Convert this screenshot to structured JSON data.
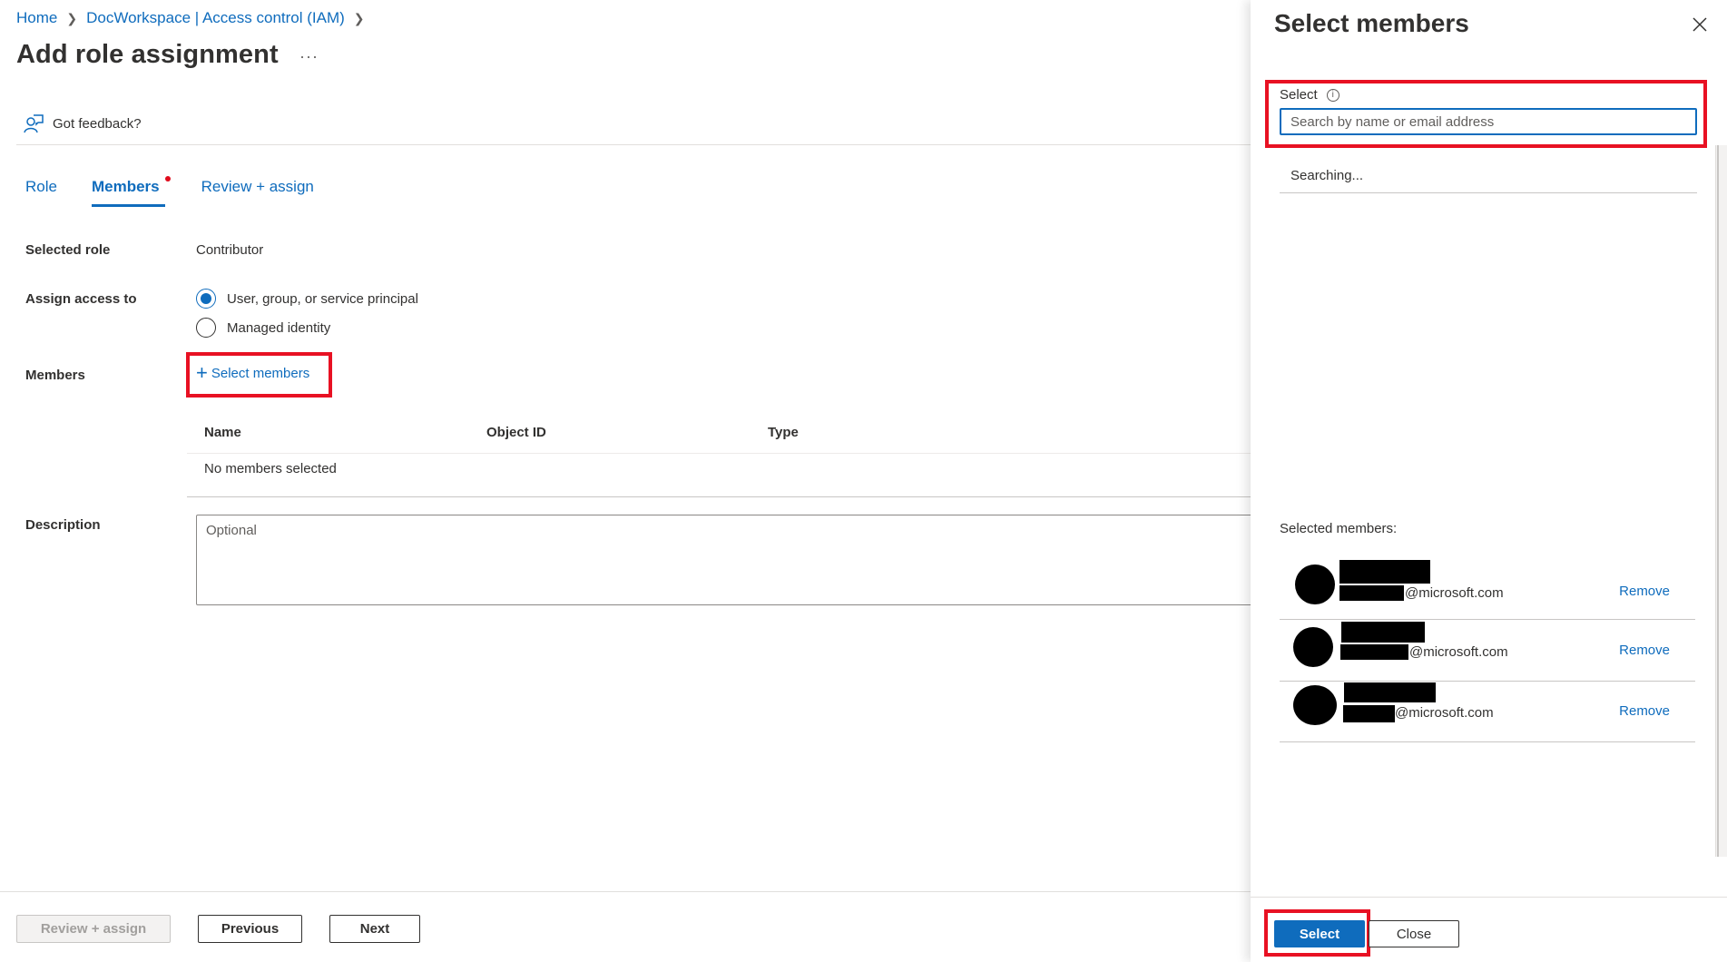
{
  "breadcrumb": [
    {
      "label": "Home"
    },
    {
      "label": "DocWorkspace | Access control (IAM)"
    }
  ],
  "page": {
    "title": "Add role assignment",
    "more_label": "···",
    "feedback_label": "Got feedback?"
  },
  "tabs": [
    {
      "label": "Role",
      "active": false
    },
    {
      "label": "Members",
      "active": true,
      "has_indicator": true
    },
    {
      "label": "Review + assign",
      "active": false
    }
  ],
  "form": {
    "selected_role_label": "Selected role",
    "selected_role_value": "Contributor",
    "assign_access_label": "Assign access to",
    "assign_options": [
      {
        "label": "User, group, or service principal",
        "checked": true
      },
      {
        "label": "Managed identity",
        "checked": false
      }
    ],
    "members_label": "Members",
    "select_members_link": "Select members",
    "table": {
      "columns": [
        "Name",
        "Object ID",
        "Type"
      ],
      "empty_text": "No members selected"
    },
    "description_label": "Description",
    "description_placeholder": "Optional"
  },
  "footer": {
    "review_assign": "Review + assign",
    "previous": "Previous",
    "next": "Next"
  },
  "panel": {
    "title": "Select members",
    "select_label": "Select",
    "search_placeholder": "Search by name or email address",
    "search_value": "",
    "status_text": "Searching...",
    "selected_members_label": "Selected members:",
    "members": [
      {
        "name": "[redacted]",
        "email_domain": "@microsoft.com",
        "remove_label": "Remove"
      },
      {
        "name": "[redacted]",
        "email_domain": "@microsoft.com",
        "remove_label": "Remove"
      },
      {
        "name": "[redacted]",
        "email_domain": "@microsoft.com",
        "remove_label": "Remove"
      }
    ],
    "select_button": "Select",
    "close_button": "Close"
  },
  "colors": {
    "accent": "#0f6cbd",
    "highlight": "#e81123",
    "text": "#323130"
  }
}
